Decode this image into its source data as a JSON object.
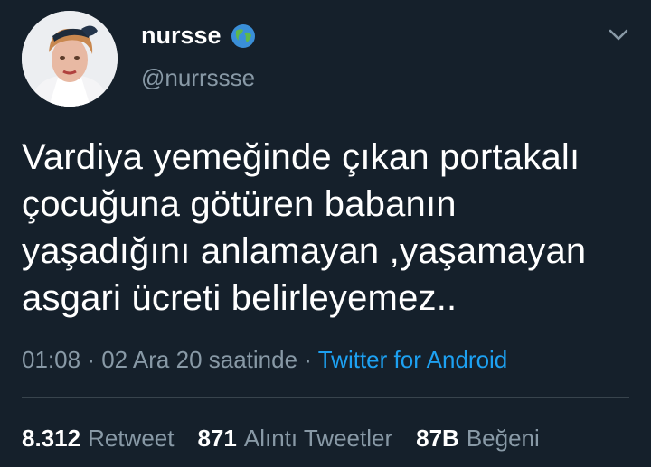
{
  "user": {
    "display_name": "nursse",
    "handle": "@nurrssse",
    "badge_icon": "globe-icon"
  },
  "tweet": {
    "lines": [
      "Vardiya yemeğinde çıkan portakalı",
      "çocuğuna götüren babanın",
      "yaşadığını anlamayan ,yaşamayan",
      "asgari ücreti belirleyemez.."
    ]
  },
  "meta": {
    "time": "01:08",
    "sep1": "·",
    "date": "02 Ara 20 saatinde",
    "sep2": "·",
    "source": "Twitter for Android"
  },
  "stats": {
    "retweets": {
      "count": "8.312",
      "label": "Retweet"
    },
    "quotes": {
      "count": "871",
      "label": "Alıntı Tweetler"
    },
    "likes": {
      "count": "87B",
      "label": "Beğeni"
    }
  },
  "colors": {
    "background": "#15202b",
    "secondary_text": "#8899a6",
    "link": "#1da1f2"
  }
}
